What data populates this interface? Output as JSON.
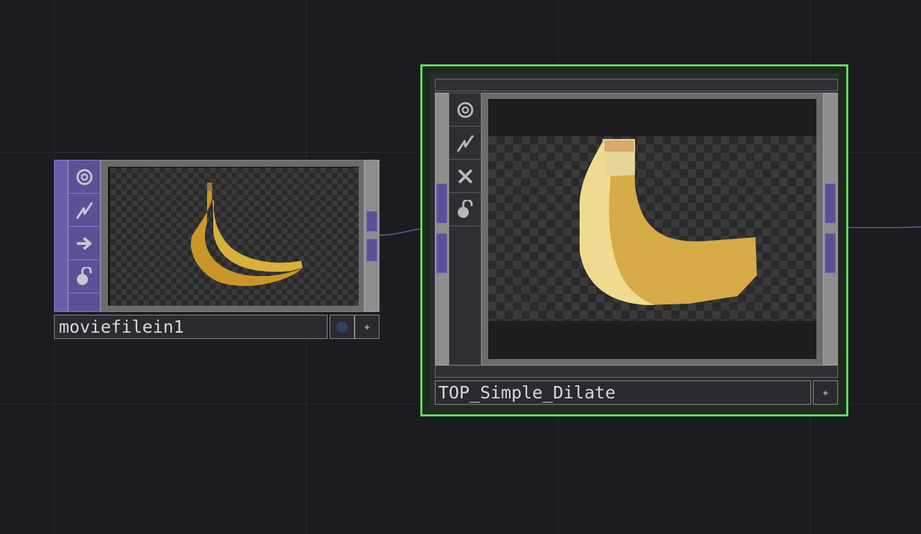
{
  "network": {
    "background": "#1b1c20",
    "nodes": [
      {
        "name": "moviefilein1",
        "type": "TOP",
        "color": "#6b5ca8",
        "flags": [
          "bypass-icon",
          "cook-icon",
          "arrow-right-icon",
          "lock-icon"
        ],
        "selected": false
      },
      {
        "name": "TOP_Simple_Dilate",
        "type": "TOP",
        "selected": true,
        "selection_color": "#5ee25a",
        "flags": [
          "bypass-icon",
          "cook-icon",
          "close-icon",
          "lock-icon"
        ]
      }
    ]
  }
}
